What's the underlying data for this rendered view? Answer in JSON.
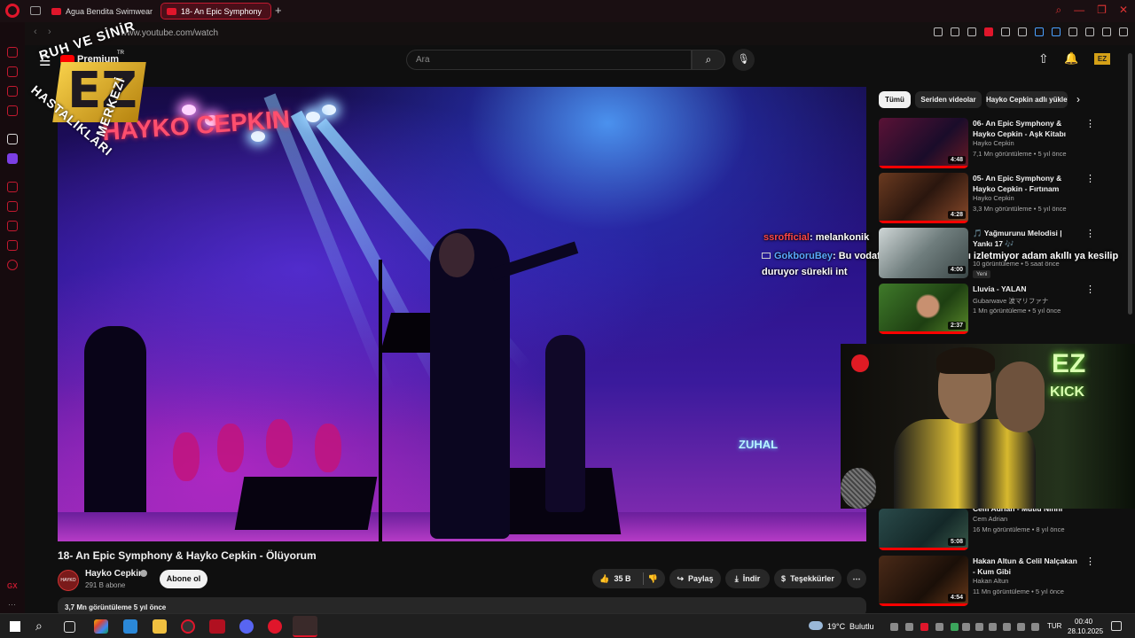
{
  "browser": {
    "tabs": [
      {
        "label": "Agua Bendita Swimwear |"
      },
      {
        "label": "18- An Epic Symphony"
      }
    ],
    "new_tab": "+",
    "url": "www.youtube.com/watch"
  },
  "youtube": {
    "logo_text": "Premium",
    "search_placeholder": "Ara",
    "avatar_text": "EZ"
  },
  "overlay": {
    "ez_logo": "EZ",
    "ruh_text": "RUH VE SİNİR",
    "hast_text": "HASTALIKLARI",
    "merk_text": "MERKEZİ",
    "tr_tag": "TR"
  },
  "video": {
    "neon_text": "HAYKO CEPKIN",
    "zuhal_sign": "ZUHAL",
    "title": "18- An Epic Symphony & Hayko Cepkin - Ölüyorum",
    "channel": "Hayko Cepkin",
    "subscribers": "291 B abone",
    "subscribe_label": "Abone ol",
    "likes": "35 B",
    "share_label": "Paylaş",
    "download_label": "İndir",
    "thanks_label": "Teşekkürler",
    "more_label": "⋯",
    "views_date": "3,7 Mn görüntüleme  5 yıl önce"
  },
  "chat": [
    {
      "user": "ssrofficial",
      "message": ": melankonik"
    },
    {
      "user": "GokboruBey",
      "message": ": Bu vodafonenet senin yayını izletmiyor adam akıllı ya kesilip"
    },
    {
      "continuation": "duruyor sürekli int"
    }
  ],
  "chips": [
    "Tümü",
    "Seriden videolar",
    "Hayko Cepkin adlı yükleyiciden"
  ],
  "recommendations": [
    {
      "title": "06- An Epic Symphony & Hayko Cepkin - Aşk Kitabı",
      "channel": "Hayko Cepkin",
      "meta": "7,1 Mn görüntüleme • 5 yıl önce",
      "duration": "4:48",
      "thumb_color": "#3a0f2a"
    },
    {
      "title": "05- An Epic Symphony & Hayko Cepkin - Fırtınam",
      "channel": "Hayko Cepkin",
      "meta": "3,3 Mn görüntüleme • 5 yıl önce",
      "duration": "4:28",
      "thumb_color": "#4a2a1a"
    },
    {
      "title": "🎵 Yağmurunu Melodisi | Yankı 17 🎶",
      "channel": "",
      "meta": "10 görüntüleme • 5 saat önce",
      "duration": "4:00",
      "badge": "Yeni",
      "thumb_color": "#5a6a6a"
    },
    {
      "title": "Lluvia - YALAN",
      "channel": "Gubarwave 波マリファナ",
      "meta": "1 Mn görüntüleme • 5 yıl önce",
      "duration": "2:37",
      "thumb_color": "#2f5a1f"
    },
    {
      "title": "Cem Adrian - Mutlu Ninni",
      "channel": "Cem Adrian",
      "meta": "16 Mn görüntüleme • 8 yıl önce",
      "duration": "5:08",
      "thumb_color": "#1f3a3a"
    },
    {
      "title": "Hakan Altun & Celil Nalçakan - Kum Gibi",
      "channel": "Hakan Altun",
      "meta": "11 Mn görüntüleme • 5 yıl önce",
      "duration": "4:54",
      "thumb_color": "#3a2214"
    }
  ],
  "webcam": {
    "neon_ez": "EZ",
    "neon_kick": "KICK"
  },
  "taskbar": {
    "temp": "19°C",
    "condition": "Bulutlu",
    "lang": "TUR",
    "time": "00:40",
    "date": "28.10.2025"
  },
  "colors": {
    "accent": "#e0162b",
    "yt_red": "#ff0000"
  }
}
